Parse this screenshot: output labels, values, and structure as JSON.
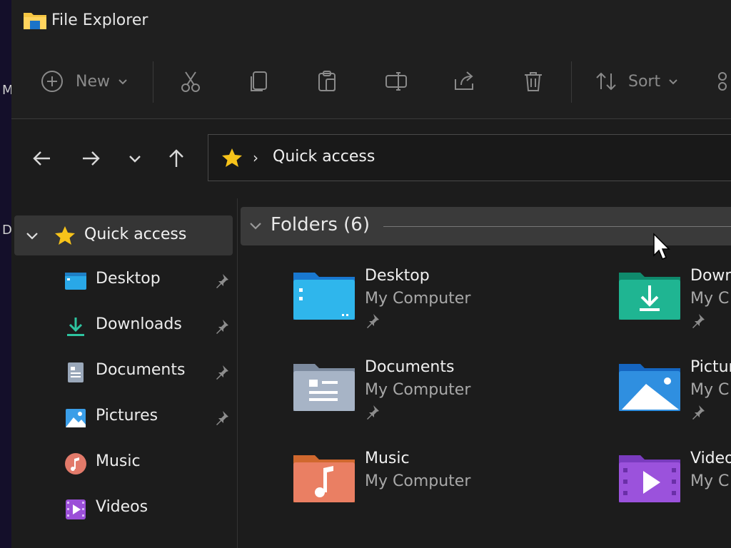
{
  "desktop": {
    "edge_letters": [
      "M",
      "D"
    ]
  },
  "window": {
    "title": "File Explorer"
  },
  "toolbar": {
    "new_label": "New",
    "sort_label": "Sort"
  },
  "address": {
    "location": "Quick access"
  },
  "sidebar": {
    "quick_access_label": "Quick access",
    "items": [
      {
        "label": "Desktop",
        "pinned": true
      },
      {
        "label": "Downloads",
        "pinned": true
      },
      {
        "label": "Documents",
        "pinned": true
      },
      {
        "label": "Pictures",
        "pinned": true
      },
      {
        "label": "Music",
        "pinned": false
      },
      {
        "label": "Videos",
        "pinned": false
      }
    ]
  },
  "main": {
    "group_header": "Folders (6)",
    "folders": [
      {
        "name": "Desktop",
        "location": "My Computer",
        "pinned": true
      },
      {
        "name": "Down",
        "location": "My C",
        "pinned": true
      },
      {
        "name": "Documents",
        "location": "My Computer",
        "pinned": true
      },
      {
        "name": "Pictur",
        "location": "My C",
        "pinned": true
      },
      {
        "name": "Music",
        "location": "My Computer",
        "pinned": false
      },
      {
        "name": "Video",
        "location": "My C",
        "pinned": false
      }
    ]
  },
  "colors": {
    "background": "#1c1c1c",
    "accent_star": "#f7c31a",
    "selected_row": "#353535",
    "group_header_bg": "#3a3a3a"
  }
}
